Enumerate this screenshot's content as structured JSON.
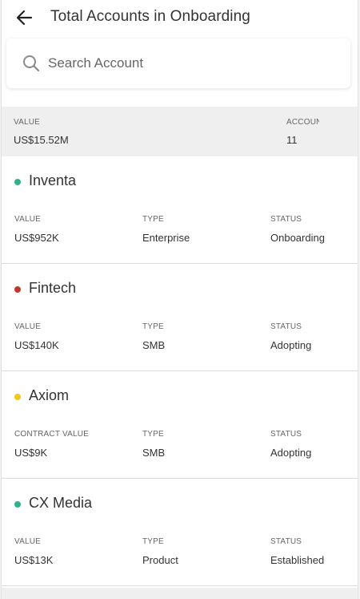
{
  "header": {
    "title": "Total Accounts in Onboarding",
    "back_icon": "arrow-left-icon"
  },
  "search": {
    "placeholder": "Search Account",
    "value": "",
    "icon": "search-icon"
  },
  "summary": {
    "value_label": "VALUE",
    "value": "US$15.52M",
    "accounts_label": "ACCOUNTS",
    "accounts": "11"
  },
  "accounts": [
    {
      "name": "Inventa",
      "status_color": "#2fb38a",
      "fields": [
        {
          "label": "VALUE",
          "value": "US$952K"
        },
        {
          "label": "TYPE",
          "value": "Enterprise"
        },
        {
          "label": "STATUS",
          "value": "Onboarding"
        }
      ]
    },
    {
      "name": "Fintech",
      "status_color": "#c0392b",
      "fields": [
        {
          "label": "VALUE",
          "value": "US$140K"
        },
        {
          "label": "TYPE",
          "value": "SMB"
        },
        {
          "label": "STATUS",
          "value": "Adopting"
        }
      ]
    },
    {
      "name": "Axiom",
      "status_color": "#f2c811",
      "fields": [
        {
          "label": "CONTRACT VALUE",
          "value": "US$9K"
        },
        {
          "label": "TYPE",
          "value": "SMB"
        },
        {
          "label": "STATUS",
          "value": "Adopting"
        }
      ]
    },
    {
      "name": "CX Media",
      "status_color": "#2fb38a",
      "fields": [
        {
          "label": "VALUE",
          "value": "US$13K"
        },
        {
          "label": "TYPE",
          "value": "Product"
        },
        {
          "label": "STATUS",
          "value": "Established"
        }
      ]
    }
  ]
}
